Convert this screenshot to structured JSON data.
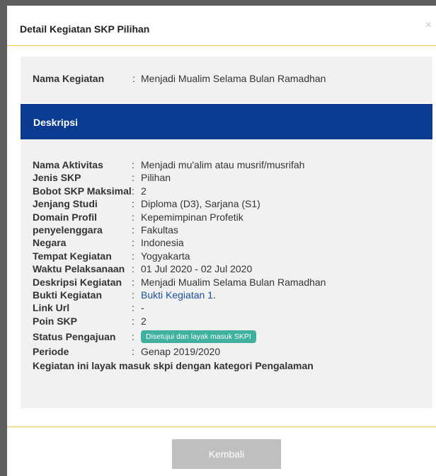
{
  "modal": {
    "title": "Detail Kegiatan SKP Pilihan",
    "close_icon": "close-icon",
    "close_glyph": "×"
  },
  "summary": {
    "label": "Nama Kegiatan",
    "separator": ":",
    "value": "Menjadi Mualim Selama Bulan Ramadhan"
  },
  "section": {
    "title": "Deskripsi"
  },
  "details": {
    "rows": [
      {
        "label": "Nama Aktivitas",
        "value": "Menjadi mu'alim atau musrif/musrifah"
      },
      {
        "label": "Jenis SKP",
        "value": "Pilihan"
      },
      {
        "label": "Bobot SKP Maksimal",
        "value": "2"
      },
      {
        "label": "Jenjang Studi",
        "value": "Diploma (D3), Sarjana (S1)"
      },
      {
        "label": "Domain Profil",
        "value": "Kepemimpinan Profetik"
      },
      {
        "label": "penyelenggara",
        "value": "Fakultas"
      },
      {
        "label": "Negara",
        "value": "Indonesia"
      },
      {
        "label": "Tempat Kegiatan",
        "value": "Yogyakarta"
      },
      {
        "label": "Waktu Pelaksanaan",
        "value": "01 Jul 2020 - 02 Jul 2020"
      },
      {
        "label": "Deskripsi Kegiatan",
        "value": "Menjadi Mualim Selama Bulan Ramadhan"
      },
      {
        "label": "Bukti Kegiatan",
        "value": "Bukti Kegiatan 1",
        "suffix": "."
      },
      {
        "label": "Link Url",
        "value": "-"
      },
      {
        "label": "Poin SKP",
        "value": "2"
      },
      {
        "label": "Status Pengajuan",
        "value": "Disetujui dan layak masuk SKPI"
      },
      {
        "label": "Periode",
        "value": "Genap 2019/2020"
      }
    ],
    "separator": ":",
    "note": "Kegiatan ini layak masuk skpi dengan kategori Pengalaman"
  },
  "footer": {
    "back_label": "Kembali"
  },
  "colors": {
    "header_blue": "#0b3a91",
    "accent_yellow": "#f4c542",
    "badge_teal": "#3fb0a0",
    "link_blue": "#1b4fa0",
    "button_gray": "#bfbfbf"
  }
}
